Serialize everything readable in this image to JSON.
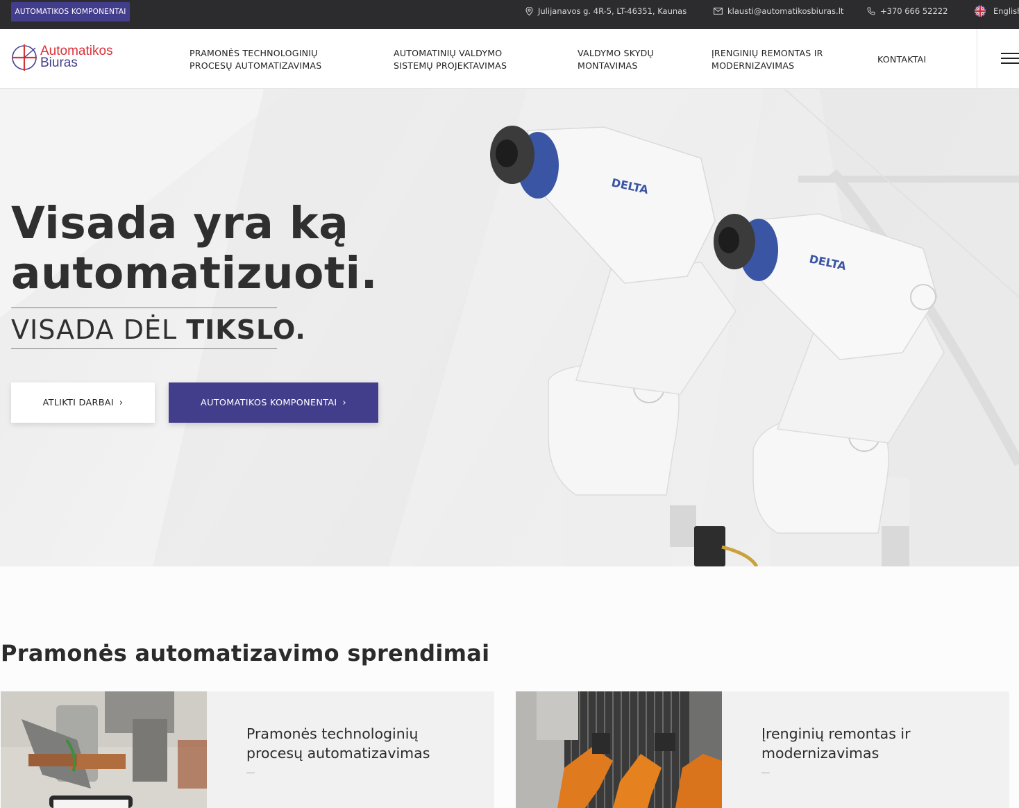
{
  "topbar": {
    "components_button": "AUTOMATIKOS KOMPONENTAI",
    "address": "Julijanavos g. 4R-5, LT-46351, Kaunas",
    "email": "klausti@automatikosbiuras.lt",
    "phone": "+370 666 52222",
    "language": "English"
  },
  "header": {
    "logo_line1": "Automatikos",
    "logo_line2": "Biuras",
    "nav": [
      {
        "line1": "PRAMONĖS TECHNOLOGINIŲ",
        "line2": "PROCESŲ AUTOMATIZAVIMAS"
      },
      {
        "line1": "AUTOMATINIŲ VALDYMO",
        "line2": "SISTEMŲ PROJEKTAVIMAS"
      },
      {
        "line1": "VALDYMO SKYDŲ",
        "line2": "MONTAVIMAS"
      },
      {
        "line1": "ĮRENGINIŲ REMONTAS IR",
        "line2": "MODERNIZAVIMAS"
      },
      {
        "line1": "KONTAKTAI",
        "line2": ""
      }
    ]
  },
  "hero": {
    "title_light": "Visada yra ką",
    "title_bold": "automatizuoti.",
    "sub_light": "VISADA DĖL ",
    "sub_bold": "TIKSLO.",
    "btn_works": "ATLIKTI DARBAI",
    "btn_components": "AUTOMATIKOS KOMPONENTAI",
    "robot_brand": "DELTA"
  },
  "solutions": {
    "title": "Pramonės automatizavimo sprendimai",
    "cards": [
      {
        "title_line1": "Pramonės technologinių",
        "title_line2": "procesų automatizavimas"
      },
      {
        "title_line1": "Įrenginių remontas ir",
        "title_line2": "modernizavimas"
      }
    ]
  },
  "colors": {
    "brand_purple": "#433e8c",
    "brand_red": "#d9333a",
    "topbar_bg": "#2c2c2e"
  },
  "icons": [
    "location-pin-icon",
    "envelope-icon",
    "phone-icon",
    "uk-flag-icon",
    "hamburger-menu-icon",
    "chevron-right-icon"
  ]
}
